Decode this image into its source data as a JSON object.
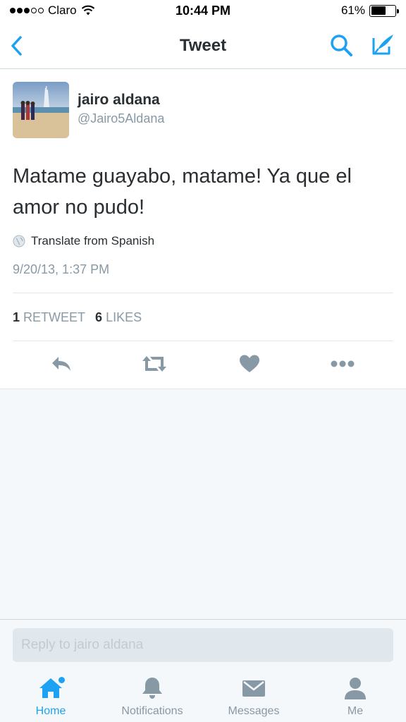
{
  "status_bar": {
    "carrier": "Claro",
    "time": "10:44 PM",
    "battery_percent": "61%",
    "battery_level": 0.61,
    "signal_bars_filled": 3,
    "signal_bars_total": 5
  },
  "nav": {
    "title": "Tweet",
    "back_icon": "chevron-left-icon",
    "search_icon": "search-icon",
    "compose_icon": "compose-tweet-icon",
    "accent_color": "#1da1f2"
  },
  "tweet": {
    "user_name": "jairo aldana",
    "user_handle": "@Jairo5Aldana",
    "text": "Matame guayabo, matame! Ya que el amor no pudo!",
    "translate_label": "Translate from Spanish",
    "timestamp": "9/20/13, 1:37 PM",
    "retweet_count": "1",
    "retweet_label": "RETWEET",
    "like_count": "6",
    "like_label": "LIKES",
    "actions": [
      "reply-icon",
      "retweet-icon",
      "heart-icon",
      "more-icon"
    ]
  },
  "reply": {
    "placeholder": "Reply to jairo aldana"
  },
  "tab_bar": {
    "tabs": [
      {
        "label": "Home",
        "icon": "home-icon",
        "active": true
      },
      {
        "label": "Notifications",
        "icon": "bell-icon",
        "active": false
      },
      {
        "label": "Messages",
        "icon": "envelope-icon",
        "active": false
      },
      {
        "label": "Me",
        "icon": "person-icon",
        "active": false
      }
    ]
  }
}
